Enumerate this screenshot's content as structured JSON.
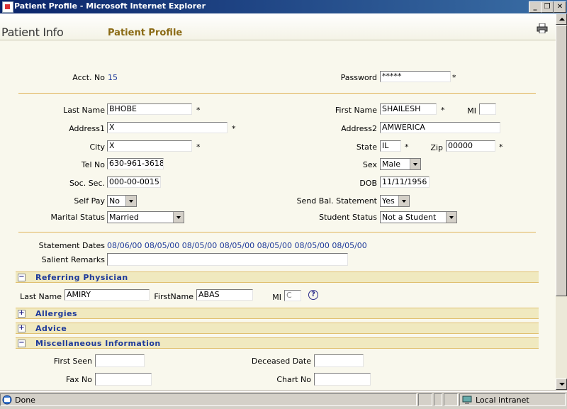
{
  "window": {
    "title": "Patient Profile - Microsoft Internet Explorer",
    "minimize": "_",
    "restore": "❐",
    "close": "✕"
  },
  "header": {
    "logo": "Patient Info",
    "page_title": "Patient Profile",
    "print_icon": "printer-icon"
  },
  "account": {
    "acct_label": "Acct. No",
    "acct_value": "15",
    "password_label": "Password",
    "password_value": "*****",
    "required": "*"
  },
  "patient": {
    "last_name_label": "Last Name",
    "last_name": "BHOBE",
    "first_name_label": "First Name",
    "first_name": "SHAILESH",
    "mi_label": "MI",
    "mi": "",
    "address1_label": "Address1",
    "address1": "X",
    "address2_label": "Address2",
    "address2": "AMWERICA",
    "city_label": "City",
    "city": "X",
    "state_label": "State",
    "state": "IL",
    "zip_label": "Zip",
    "zip": "00000",
    "tel_label": "Tel No",
    "tel": "630-961-3618",
    "sex_label": "Sex",
    "sex": "Male",
    "ssn_label": "Soc. Sec.",
    "ssn": "000-00-0015",
    "dob_label": "DOB",
    "dob": "11/11/1956",
    "self_pay_label": "Self Pay",
    "self_pay": "No",
    "send_bal_label": "Send Bal. Statement",
    "send_bal": "Yes",
    "marital_label": "Marital Status",
    "marital": "Married",
    "student_label": "Student Status",
    "student": "Not a Student"
  },
  "statements": {
    "label": "Statement Dates",
    "dates": "08/06/00 08/05/00 08/05/00 08/05/00 08/05/00 08/05/00 08/05/00",
    "remarks_label": "Salient Remarks",
    "remarks": ""
  },
  "sections": {
    "referring": "Referring Physician",
    "allergies": "Allergies",
    "advice": "Advice",
    "misc": "Miscellaneous Information",
    "collapse": "−",
    "expand": "+"
  },
  "physician": {
    "last_name_label": "Last Name",
    "last_name": "AMIRY",
    "first_name_label": "FirstName",
    "first_name": "ABAS",
    "mi_label": "MI",
    "mi": "C",
    "help": "?"
  },
  "misc": {
    "first_seen_label": "First Seen",
    "first_seen": "",
    "deceased_label": "Deceased Date",
    "deceased": "",
    "fax_label": "Fax No",
    "fax": "",
    "chart_label": "Chart No",
    "chart": ""
  },
  "statusbar": {
    "status": "Done",
    "zone": "Local intranet"
  }
}
